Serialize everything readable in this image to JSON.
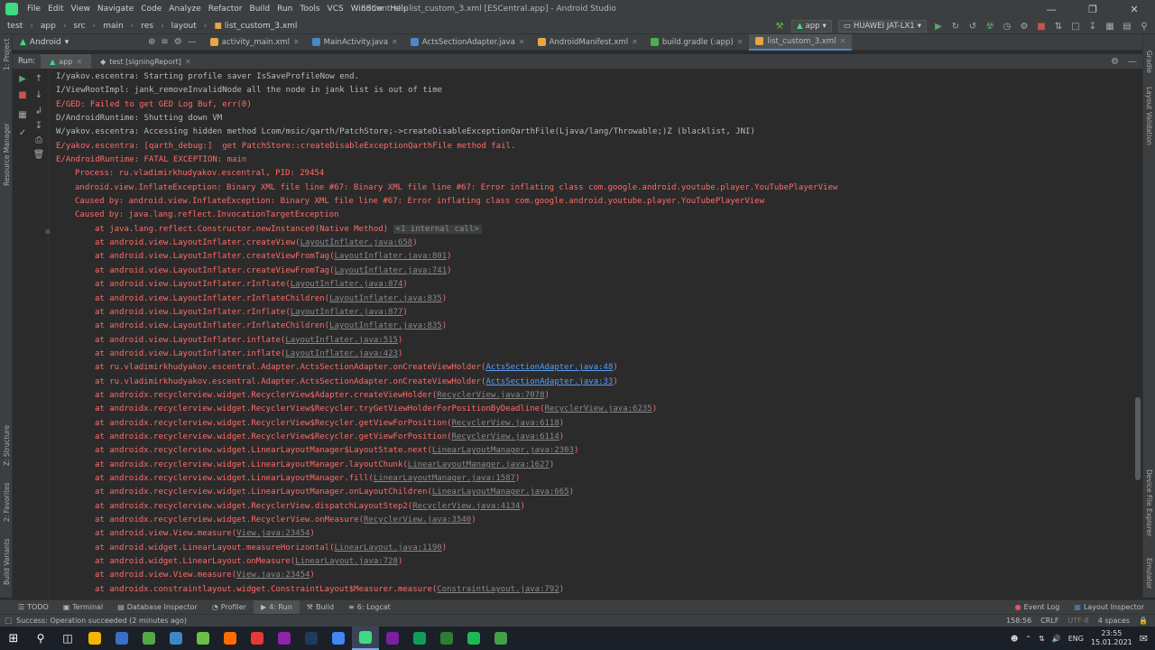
{
  "window": {
    "title": "ESCentral - list_custom_3.xml [ESCentral.app] - Android Studio",
    "minimize_icon": "minimize-icon",
    "maximize_icon": "restore-icon",
    "close_icon": "close-icon"
  },
  "menu": [
    "File",
    "Edit",
    "View",
    "Navigate",
    "Code",
    "Analyze",
    "Refactor",
    "Build",
    "Run",
    "Tools",
    "VCS",
    "Window",
    "Help"
  ],
  "breadcrumbs": [
    "test",
    "app",
    "src",
    "main",
    "res",
    "layout",
    "list_custom_3.xml"
  ],
  "toolbar": {
    "config": "app",
    "device": "HUAWEI JAT-LX1"
  },
  "project_view": {
    "label": "Android"
  },
  "tabs": [
    {
      "label": "activity_main.xml",
      "color": "#e8a545"
    },
    {
      "label": "MainActivity.java",
      "color": "#4a88c7"
    },
    {
      "label": "ActsSectionAdapter.java",
      "color": "#4a88c7"
    },
    {
      "label": "AndroidManifest.xml",
      "color": "#e8a545"
    },
    {
      "label": "build.gradle (:app)",
      "color": "#4caf50"
    },
    {
      "label": "list_custom_3.xml",
      "color": "#e8a545"
    }
  ],
  "left_stripe": [
    "1: Project",
    "Resource Manager",
    "Z: Structure",
    "2: Favorites",
    "Build Variants"
  ],
  "right_stripe": [
    "Gradle",
    "Layout Validation",
    "Device File Explorer",
    "Emulator"
  ],
  "run": {
    "label": "Run:",
    "tabs": [
      "app",
      "test [signingReport]"
    ]
  },
  "console": {
    "lines": [
      {
        "t": "I/yakov.escentra: Starting profile saver IsSaveProfileNow end.",
        "c": "info",
        "i": 0
      },
      {
        "t": "I/ViewRootImpl: jank_removeInvalidNode all the node in jank list is out of time",
        "c": "info",
        "i": 0
      },
      {
        "t": "E/GED: Failed to get GED Log Buf, err(0)",
        "c": "err",
        "i": 0
      },
      {
        "t": "D/AndroidRuntime: Shutting down VM",
        "c": "info",
        "i": 0
      },
      {
        "t": "W/yakov.escentra: Accessing hidden method Lcom/msic/qarth/PatchStore;->createDisableExceptionQarthFile(Ljava/lang/Throwable;)Z (blacklist, JNI)",
        "c": "info",
        "i": 0
      },
      {
        "t": "E/yakov.escentra: [qarth_debug:]  get PatchStore::createDisableExceptionQarthFile method fail.",
        "c": "err",
        "i": 0
      },
      {
        "t": "E/AndroidRuntime: FATAL EXCEPTION: main",
        "c": "err",
        "i": 0
      },
      {
        "t": "Process: ru.vladimirkhudyakov.escentral, PID: 29454",
        "c": "err",
        "i": 1
      },
      {
        "t": "android.view.InflateException: Binary XML file line #67: Binary XML file line #67: Error inflating class com.google.android.youtube.player.YouTubePlayerView",
        "c": "err",
        "i": 1
      },
      {
        "t": "Caused by: android.view.InflateException: Binary XML file line #67: Error inflating class com.google.android.youtube.player.YouTubePlayerView",
        "c": "err",
        "i": 1
      },
      {
        "t": "Caused by: java.lang.reflect.InvocationTargetException",
        "c": "err",
        "i": 1
      },
      {
        "t": "at java.lang.reflect.Constructor.newInstance0(Native Method)",
        "c": "err",
        "i": 2,
        "badge": "<1 internal call>"
      },
      {
        "t": "at android.view.LayoutInflater.createView(",
        "c": "err",
        "i": 2,
        "link": "LayoutInflater.java:658"
      },
      {
        "t": "at android.view.LayoutInflater.createViewFromTag(",
        "c": "err",
        "i": 2,
        "link": "LayoutInflater.java:801"
      },
      {
        "t": "at android.view.LayoutInflater.createViewFromTag(",
        "c": "err",
        "i": 2,
        "link": "LayoutInflater.java:741"
      },
      {
        "t": "at android.view.LayoutInflater.rInflate(",
        "c": "err",
        "i": 2,
        "link": "LayoutInflater.java:874"
      },
      {
        "t": "at android.view.LayoutInflater.rInflateChildren(",
        "c": "err",
        "i": 2,
        "link": "LayoutInflater.java:835"
      },
      {
        "t": "at android.view.LayoutInflater.rInflate(",
        "c": "err",
        "i": 2,
        "link": "LayoutInflater.java:877"
      },
      {
        "t": "at android.view.LayoutInflater.rInflateChildren(",
        "c": "err",
        "i": 2,
        "link": "LayoutInflater.java:835"
      },
      {
        "t": "at android.view.LayoutInflater.inflate(",
        "c": "err",
        "i": 2,
        "link": "LayoutInflater.java:515"
      },
      {
        "t": "at android.view.LayoutInflater.inflate(",
        "c": "err",
        "i": 2,
        "link": "LayoutInflater.java:423"
      },
      {
        "t": "at ru.vladimirkhudyakov.escentral.Adapter.ActsSectionAdapter.onCreateViewHolder(",
        "c": "err",
        "i": 2,
        "link": "ActsSectionAdapter.java:48",
        "blue": true
      },
      {
        "t": "at ru.vladimirkhudyakov.escentral.Adapter.ActsSectionAdapter.onCreateViewHolder(",
        "c": "err",
        "i": 2,
        "link": "ActsSectionAdapter.java:33",
        "blue": true
      },
      {
        "t": "at androidx.recyclerview.widget.RecyclerView$Adapter.createViewHolder(",
        "c": "err",
        "i": 2,
        "link": "RecyclerView.java:7078"
      },
      {
        "t": "at androidx.recyclerview.widget.RecyclerView$Recycler.tryGetViewHolderForPositionByDeadline(",
        "c": "err",
        "i": 2,
        "link": "RecyclerView.java:6235"
      },
      {
        "t": "at androidx.recyclerview.widget.RecyclerView$Recycler.getViewForPosition(",
        "c": "err",
        "i": 2,
        "link": "RecyclerView.java:6118"
      },
      {
        "t": "at androidx.recyclerview.widget.RecyclerView$Recycler.getViewForPosition(",
        "c": "err",
        "i": 2,
        "link": "RecyclerView.java:6114"
      },
      {
        "t": "at androidx.recyclerview.widget.LinearLayoutManager$LayoutState.next(",
        "c": "err",
        "i": 2,
        "link": "LinearLayoutManager.java:2303"
      },
      {
        "t": "at androidx.recyclerview.widget.LinearLayoutManager.layoutChunk(",
        "c": "err",
        "i": 2,
        "link": "LinearLayoutManager.java:1627"
      },
      {
        "t": "at androidx.recyclerview.widget.LinearLayoutManager.fill(",
        "c": "err",
        "i": 2,
        "link": "LinearLayoutManager.java:1587"
      },
      {
        "t": "at androidx.recyclerview.widget.LinearLayoutManager.onLayoutChildren(",
        "c": "err",
        "i": 2,
        "link": "LinearLayoutManager.java:665"
      },
      {
        "t": "at androidx.recyclerview.widget.RecyclerView.dispatchLayoutStep2(",
        "c": "err",
        "i": 2,
        "link": "RecyclerView.java:4134"
      },
      {
        "t": "at androidx.recyclerview.widget.RecyclerView.onMeasure(",
        "c": "err",
        "i": 2,
        "link": "RecyclerView.java:3540"
      },
      {
        "t": "at android.view.View.measure(",
        "c": "err",
        "i": 2,
        "link": "View.java:23454"
      },
      {
        "t": "at android.widget.LinearLayout.measureHorizontal(",
        "c": "err",
        "i": 2,
        "link": "LinearLayout.java:1190"
      },
      {
        "t": "at android.widget.LinearLayout.onMeasure(",
        "c": "err",
        "i": 2,
        "link": "LinearLayout.java:728"
      },
      {
        "t": "at android.view.View.measure(",
        "c": "err",
        "i": 2,
        "link": "View.java:23454"
      },
      {
        "t": "at androidx.constraintlayout.widget.ConstraintLayout$Measurer.measure(",
        "c": "err",
        "i": 2,
        "link": "ConstraintLayout.java:792"
      }
    ]
  },
  "bottom_tabs": [
    "TODO",
    "Terminal",
    "Database Inspector",
    "Profiler",
    "4: Run",
    "Build",
    "6: Logcat"
  ],
  "bottom_right": [
    "Event Log",
    "Layout Inspector"
  ],
  "status": {
    "message": "Success: Operation succeeded (2 minutes ago)",
    "position": "158:56",
    "line_sep": "CRLF",
    "encoding": "UTF-8",
    "indent": "4 spaces"
  },
  "taskbar": {
    "lang": "ENG",
    "time": "23:55",
    "date": "15.01.2021",
    "apps": [
      "#f5b400",
      "#3c6ec8",
      "#56a845",
      "#3d88c4",
      "#6cc04a",
      "#ff6d00",
      "#e53935",
      "#8e24aa",
      "#1e3a5f",
      "#4285f4",
      "#3ddc84",
      "#7b1fa2",
      "#0f9d58",
      "#2e7d32",
      "#1db954",
      "#43a047"
    ]
  }
}
